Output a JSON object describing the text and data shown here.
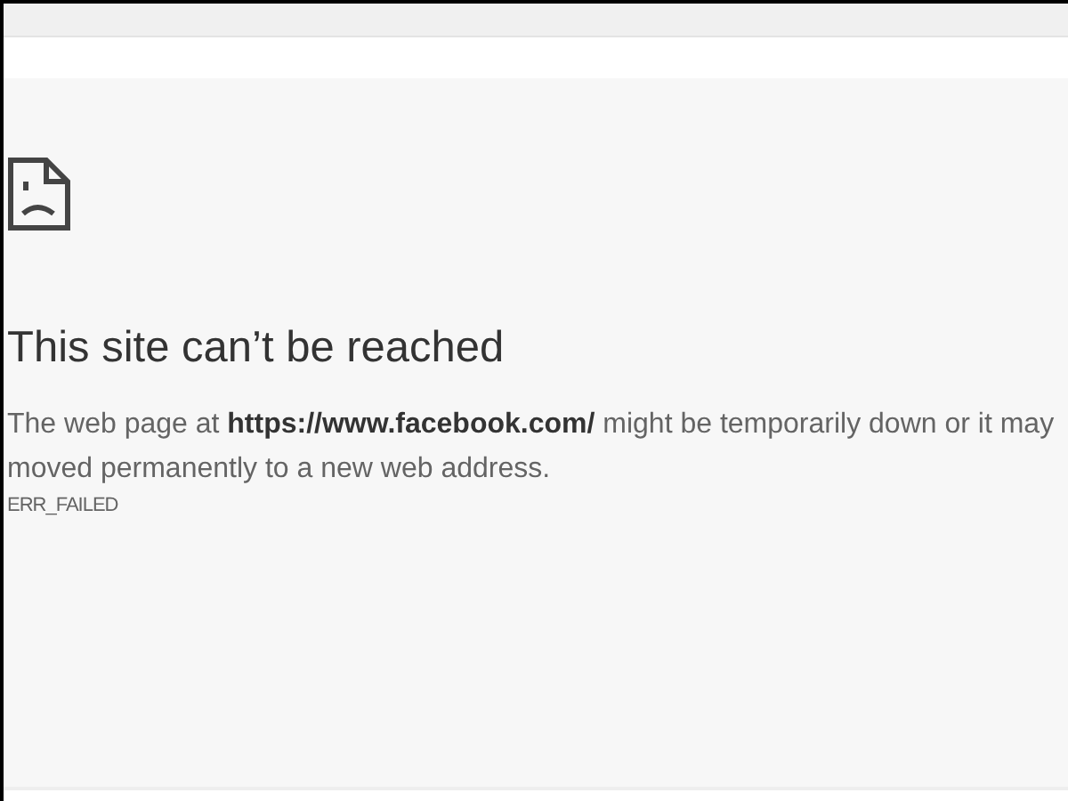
{
  "error": {
    "title": "This site can’t be reached",
    "message_lines": [
      "The web page at **https://www.facebook.com/** might be temporarily down or it may",
      "moved permanently to a new web address."
    ],
    "code": "ERR_FAILED"
  }
}
